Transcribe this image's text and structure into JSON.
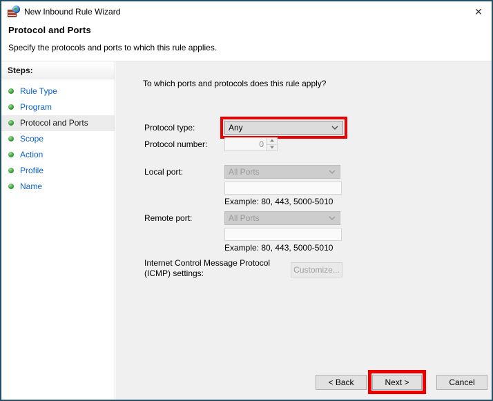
{
  "window": {
    "title": "New Inbound Rule Wizard",
    "close_glyph": "✕"
  },
  "header": {
    "title": "Protocol and Ports",
    "subtitle": "Specify the protocols and ports to which this rule applies."
  },
  "sidebar": {
    "title": "Steps:",
    "items": [
      {
        "label": "Rule Type",
        "current": false
      },
      {
        "label": "Program",
        "current": false
      },
      {
        "label": "Protocol and Ports",
        "current": true
      },
      {
        "label": "Scope",
        "current": false
      },
      {
        "label": "Action",
        "current": false
      },
      {
        "label": "Profile",
        "current": false
      },
      {
        "label": "Name",
        "current": false
      }
    ]
  },
  "main": {
    "question": "To which ports and protocols does this rule apply?",
    "protocol_type": {
      "label": "Protocol type:",
      "value": "Any"
    },
    "protocol_number": {
      "label": "Protocol number:",
      "value": "0"
    },
    "local_port": {
      "label": "Local port:",
      "value": "All Ports",
      "input_value": "",
      "example": "Example: 80, 443, 5000-5010"
    },
    "remote_port": {
      "label": "Remote port:",
      "value": "All Ports",
      "input_value": "",
      "example": "Example: 80, 443, 5000-5010"
    },
    "icmp": {
      "label_line1": "Internet Control Message Protocol",
      "label_line2": "(ICMP) settings:",
      "customize_label": "Customize..."
    }
  },
  "footer": {
    "back_label": "< Back",
    "next_label": "Next >",
    "cancel_label": "Cancel"
  },
  "colors": {
    "window_border": "#235066",
    "annotation_red": "#ee0000",
    "link_blue": "#0b63cc",
    "panel_gray": "#f0f0f0"
  }
}
